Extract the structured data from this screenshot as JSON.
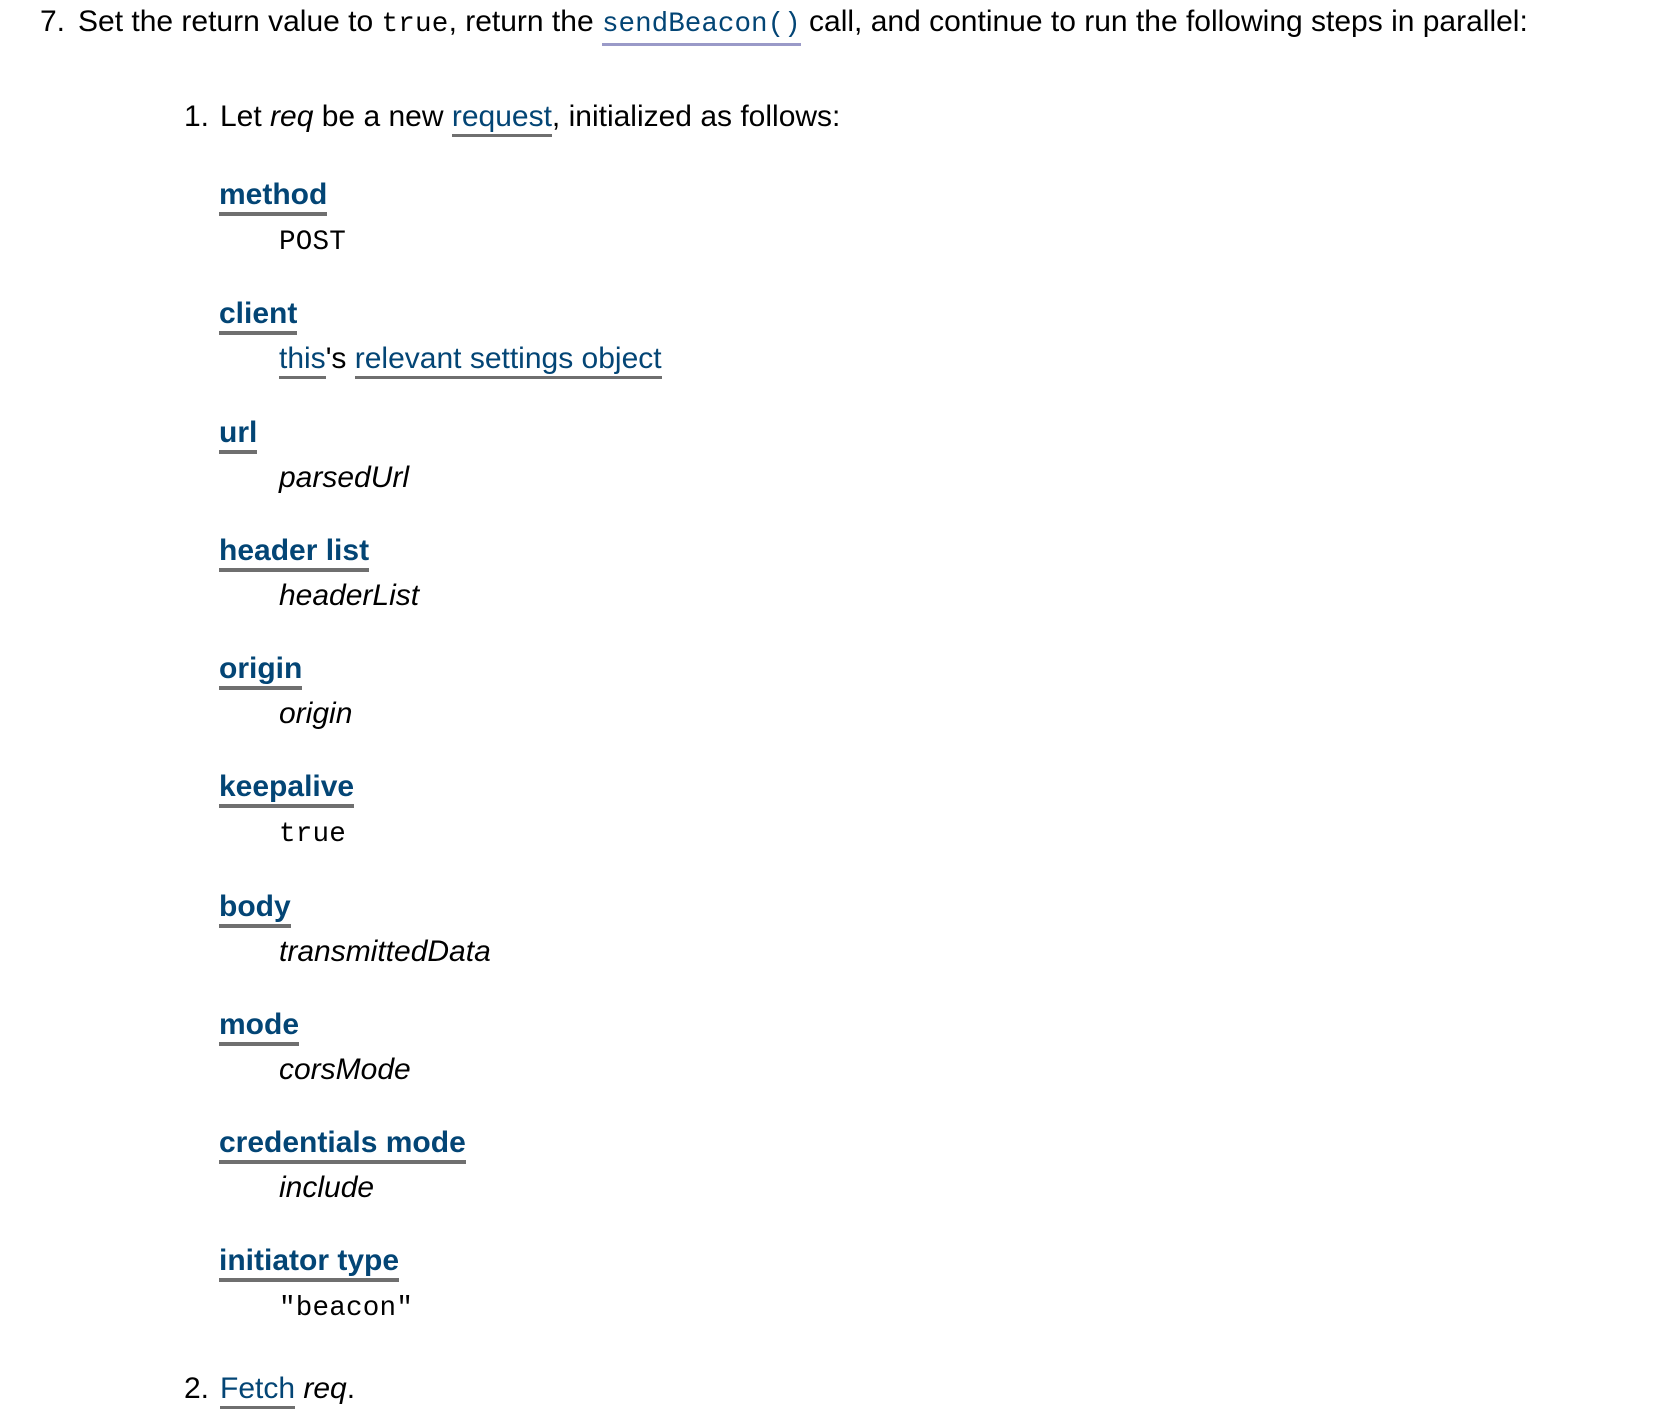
{
  "document": {
    "type": "spec-algorithm-fragment",
    "link_color": "#034575",
    "link_underline_color": "#6f6f6f",
    "idl_underline_color": "#9a9ac8",
    "text_color": "#000000",
    "background_color": "#ffffff"
  },
  "step": {
    "marker": "7.",
    "text_part_1": "Set the return value to ",
    "code_true": "true",
    "text_part_2": ", return the ",
    "idl_link": "sendBeacon()",
    "text_part_3": " call, and continue to run the following steps in parallel:"
  },
  "substeps": [
    {
      "marker": "1.",
      "text_part_1": "Let ",
      "var_req": "req",
      "text_part_2": " be a new ",
      "link_request": "request",
      "text_part_3": ", initialized as follows:"
    },
    {
      "marker": "2.",
      "link_fetch": "Fetch",
      "space": " ",
      "var_req": "req",
      "period": "."
    }
  ],
  "definitions": [
    {
      "term": "method",
      "term_kind": "link",
      "value": "POST",
      "value_kind": "code"
    },
    {
      "term": "client",
      "term_kind": "link",
      "value": "this's relevant settings object",
      "value_kind": "composite",
      "value_parts": [
        {
          "text": "this",
          "kind": "link"
        },
        {
          "text": "'s ",
          "kind": "plain"
        },
        {
          "text": "relevant settings object",
          "kind": "link"
        }
      ]
    },
    {
      "term": "url",
      "term_kind": "link",
      "value": "parsedUrl",
      "value_kind": "var"
    },
    {
      "term": "header list",
      "term_kind": "link",
      "value": "headerList",
      "value_kind": "var"
    },
    {
      "term": "origin",
      "term_kind": "link",
      "value": "origin",
      "value_kind": "var"
    },
    {
      "term": "keepalive",
      "term_kind": "link",
      "value": "true",
      "value_kind": "code"
    },
    {
      "term": "body",
      "term_kind": "link",
      "value": "transmittedData",
      "value_kind": "var"
    },
    {
      "term": "mode",
      "term_kind": "link",
      "value": "corsMode",
      "value_kind": "var"
    },
    {
      "term": "credentials mode",
      "term_kind": "link",
      "value": "include",
      "value_kind": "var"
    },
    {
      "term": "initiator type",
      "term_kind": "link",
      "value": "\"beacon\"",
      "value_kind": "code"
    }
  ]
}
